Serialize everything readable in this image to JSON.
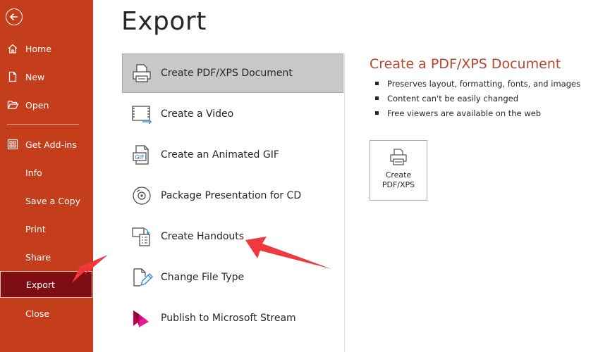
{
  "sidebar": {
    "items": [
      {
        "label": "Home"
      },
      {
        "label": "New"
      },
      {
        "label": "Open"
      },
      {
        "label": "Get Add-ins"
      },
      {
        "label": "Info"
      },
      {
        "label": "Save a Copy"
      },
      {
        "label": "Print"
      },
      {
        "label": "Share"
      },
      {
        "label": "Export"
      },
      {
        "label": "Close"
      }
    ]
  },
  "page": {
    "title": "Export"
  },
  "options": [
    {
      "label": "Create PDF/XPS Document",
      "icon": "pdf-document-icon"
    },
    {
      "label": "Create a Video",
      "icon": "video-icon"
    },
    {
      "label": "Create an Animated GIF",
      "icon": "gif-icon"
    },
    {
      "label": "Package Presentation for CD",
      "icon": "cd-icon"
    },
    {
      "label": "Create Handouts",
      "icon": "handouts-icon"
    },
    {
      "label": "Change File Type",
      "icon": "change-file-type-icon"
    },
    {
      "label": "Publish to Microsoft Stream",
      "icon": "stream-icon"
    }
  ],
  "detail": {
    "title": "Create a PDF/XPS Document",
    "bullets": [
      "Preserves layout, formatting, fonts, and images",
      "Content can't be easily changed",
      "Free viewers are available on the web"
    ],
    "button_line1": "Create",
    "button_line2": "PDF/XPS"
  },
  "gif_badge": "GIF",
  "colors": {
    "sidebar": "#c43e1c",
    "sidebar_active": "#7f0e14",
    "accent_text": "#b7472a",
    "selected_option": "#c8c8c8",
    "annotation_arrow": "#f0393c"
  }
}
